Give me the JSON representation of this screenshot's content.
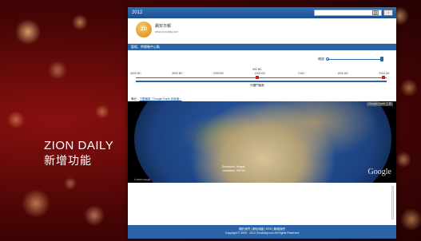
{
  "caption": {
    "line1": "ZION DAILY",
    "line2": "新增功能"
  },
  "window": {
    "title": "2012"
  },
  "header": {
    "logo_mark": "ZD",
    "logo_name": "錫安日報",
    "logo_url": "www.ziondaily.com"
  },
  "section": {
    "title": "聖經、時間軸中心點"
  },
  "timeline": {
    "zoom_label": "縮放",
    "ticks": [
      "4000 BC",
      "3000 BC",
      "2000 BC",
      "1000 BC",
      "0 AD",
      "1000 AD",
      "2000 AD"
    ],
    "marker_label": "992 BC",
    "range_label": "所羅門聖殿"
  },
  "map": {
    "link_prefix": "備註：",
    "link_text": "下載最新「Google Earth 出版值」",
    "tools_label": "Google Earth 工具",
    "center_text_1": "Solomon's Temple",
    "center_text_2": "Jerusalem, 992 BC",
    "google_brand": "Google",
    "copyright": "© 2012 Google"
  },
  "footer": {
    "links": "關於我們 | 網站地圖 | RSS | 聯絡我們",
    "copyright": "Copyright © 2009 - 2012 ZionDaily.com All Rights Reserved"
  }
}
